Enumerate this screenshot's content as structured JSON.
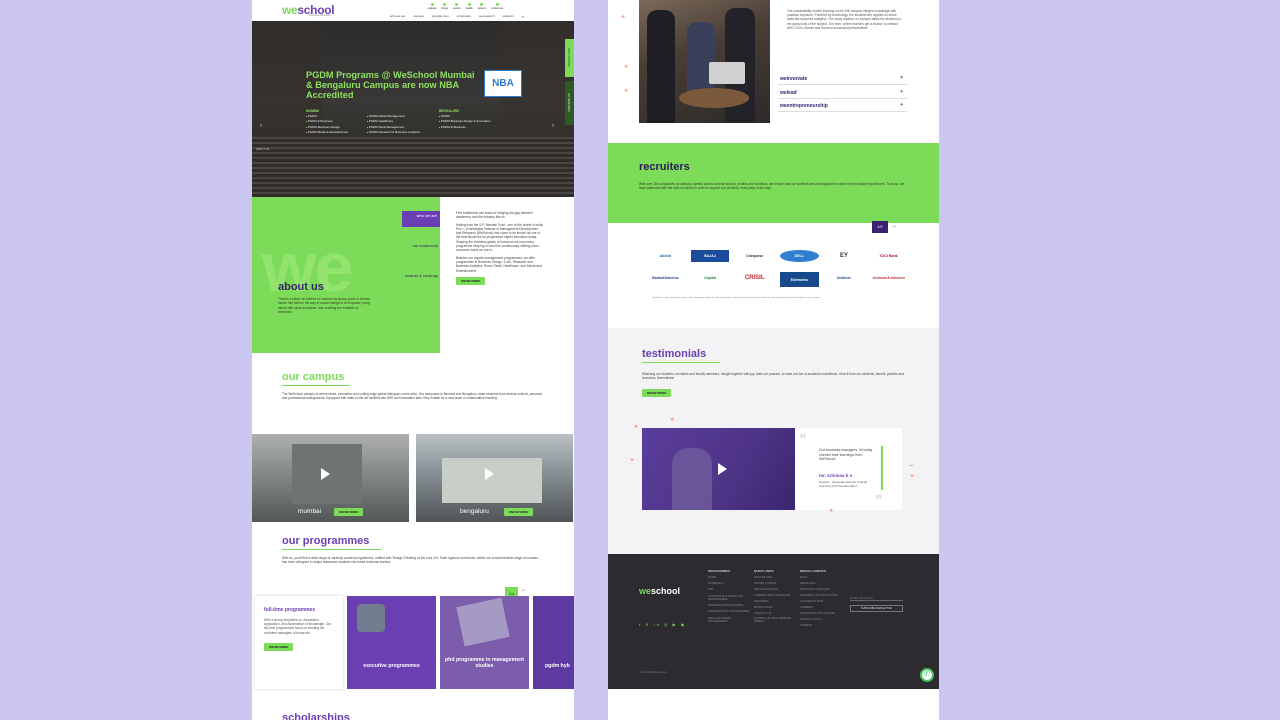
{
  "header": {
    "logo_mark": "we",
    "logo_text": "school",
    "logo_sub": "Welingkar Education",
    "top_links": [
      "enquire",
      "blogs",
      "events",
      "media",
      "careers",
      "contact us"
    ],
    "nav": [
      "who we are",
      "campus",
      "programmes",
      "corporates",
      "weresearch",
      "welambr"
    ]
  },
  "hero": {
    "title": "PGDM Programs @ WeSchool Mumbai & Bengaluru Campus are now NBA Accredited",
    "badge": "NBA",
    "mumbai_label": "MUMBAI",
    "mumbai_col1": [
      "PGDM",
      "PGDM E Business",
      "PGDM Business Design",
      "PGDM Media & Entertainment"
    ],
    "mumbai_col2": [
      "PGDM Retail Management",
      "PGDM Healthcare",
      "PGDM Rural Management",
      "PGDM Research & Business Analytics"
    ],
    "bengaluru_label": "BENGALURU",
    "bengaluru_list": [
      "PGDM",
      "PGDM Business Design & Innovation",
      "PGDM E-Business"
    ],
    "side_tabs": [
      "ENQUIRE NOW",
      "CHAT WITH US"
    ],
    "about_us_link": "ABOUT US"
  },
  "about": {
    "title": "about us",
    "text": "There's a future we believe in, fostered by strong pools of diverse minds. We believe the way to social change is to empower young minds with value education. Also creating the enablers of tomorrow.",
    "nav": [
      "who we are",
      "our leadership",
      "awards & rankings"
    ],
    "right_text_1": "Few institutions can boast of bridging the gap between academics and the industry like us.",
    "right_text_2": "Hailing from the S.P. Mandali Trust - one of the oldest in India; Prin. L.N.Welingkar Institute of Management Development and Research (WeSchool) has come to be known as one of the best Business for progressive higher education today. Shaping the business giants of tomorrow we now every programme keeping in mind the continuously shifting socio-economic world we are in.",
    "right_text_3": "Besides our regular management programmes, we offer programmes in Business Design, E-biz, Research and Business Analytics, Rural, Retail, Healthcare, and Media and Entertainment.",
    "button": "KNOW MORE"
  },
  "campus": {
    "title": "our campus",
    "text": "The WeSchool campus is where ideas, innovation and cutting edge global dialogues come alive. Our campuses in Mumbai and Bengaluru, draw students from diverse cultural, personal and professional backgrounds. Equipped with state-of-the-art facilities like WiFi and innovation labs, they enable for a new wave of collaborative learning.",
    "tiles": [
      {
        "label": "mumbai",
        "button": "KNOW MORE"
      },
      {
        "label": "bengaluru",
        "button": "KNOW MORE"
      }
    ]
  },
  "programmes": {
    "title": "our programmes",
    "text": "With us, you'll find a wide range of carefully curated programmes, crafted with 'Design Thinking' at the core of it. Each rigorous curriculum, within our comprehensive range of courses, has been designed to shape classroom students into future business leaders.",
    "pager": "1/4",
    "featured_title": "full-time programmes",
    "featured_text": "With a strong emphasis on, Acquisition, Application, and Assimilation of knowledge. Our full-time programmes focus on creating the confident managers of tomorrow.",
    "featured_button": "KNOW MORE",
    "tiles": [
      "executive programmes",
      "phd programme in management studies",
      "pgdm hyb"
    ],
    "next_title": "scholarships"
  },
  "right": {
    "we_text": "The sustainability centric learning on the WE campus merges knowledge with practical exposure. Powered by technology, the students are applied on future skills like business analytics. The study duration on campus takes the students to the grassroots of the subject. It is here, where learners get a chance to interact with CXO's, Alumni and honored successful personalities.",
    "accordion": [
      {
        "label": "weinnovate",
        "sign": "×"
      },
      {
        "label": "welead",
        "sign": "+"
      },
      {
        "label": "weentrepreneurship",
        "sign": "+"
      }
    ],
    "recruiters_title": "recruiters",
    "recruiters_text": "With over 350 companies on campus, spread across several sectors, profiles and functions, we ensure that our students are well equipped to meet every industry requirement. To do so, we have partnered with the right recruiters in order to support our students, every step of the way.",
    "recruiters_pager": "1/2",
    "logos": [
      "Abbott",
      "BAJAJ",
      "Cravpaise",
      "DELL",
      "EY",
      "ICICI Bank",
      "BankofAmerica",
      "Capital",
      "CRISIL",
      "Edelweiss",
      "Unilever",
      "Johnson&Johnson"
    ],
    "logos_note": "Disclaimer: Logos and brand names of the companies featured in the logo banner showcase the actual recruiters who have offered placements to the students at our campus.",
    "testimonials_title": "testimonials",
    "testimonials_text": "Watching our students, recruiters and faculty members, mingle together with joy, fuels our passion, to raise our bar of academic excellence. Hear it from our students, alumni, parents and recruiters, themselves!",
    "testimonials_button": "KNOW MORE",
    "quote_text": "Our business managers, till today cherish their learnings from WeSchool.",
    "quote_name": "mr. srinivas k s",
    "quote_role": "Director - Associate Director & Head Learning and Transformation",
    "footer_logo_mark": "we",
    "footer_logo_text": "school",
    "footer_cols": [
      {
        "head": "PROGRAMMES",
        "items": [
          "PGDM",
          "PGDM(Sem)",
          "PhD",
          "CORPORATE & EXECUTIVE PROGRAMMES",
          "RESEARCH PROGRAMMES",
          "INTERNATIONAL PROGRAMMES",
          "SMALL BUSINESS PROGRAMMES"
        ]
      },
      {
        "head": "QUICK LINKS",
        "items": [
          "WHO WE ARE",
          "ALUMNI LOUNGE",
          "MEDIA RELATIONS",
          "CAREERS WITH WESCHOOL",
          "PARTNERS",
          "BOOKS NEWS",
          "CONTACT US",
          "NATIONAL ALUMNI WEBINAR SERIES"
        ]
      },
      {
        "head": "MISCELLANEOUS",
        "items": [
          "BLOG",
          "MEDIA WALL",
          "WESCHOOL ARTICLES",
          "RESEARCH & PUBLICATIONS",
          "ACCREDITATIONS",
          "CAREERS",
          "MANDATORY DISCLOSURE",
          "PRIVACY POLICY",
          "SITEMAP"
        ]
      }
    ],
    "subscribe_placeholder": "ENTER YOUR EMAIL",
    "subscribe_button": "SUBSCRIBE NEWSLETTER",
    "copyright": "© 2020 All rights reserved"
  }
}
